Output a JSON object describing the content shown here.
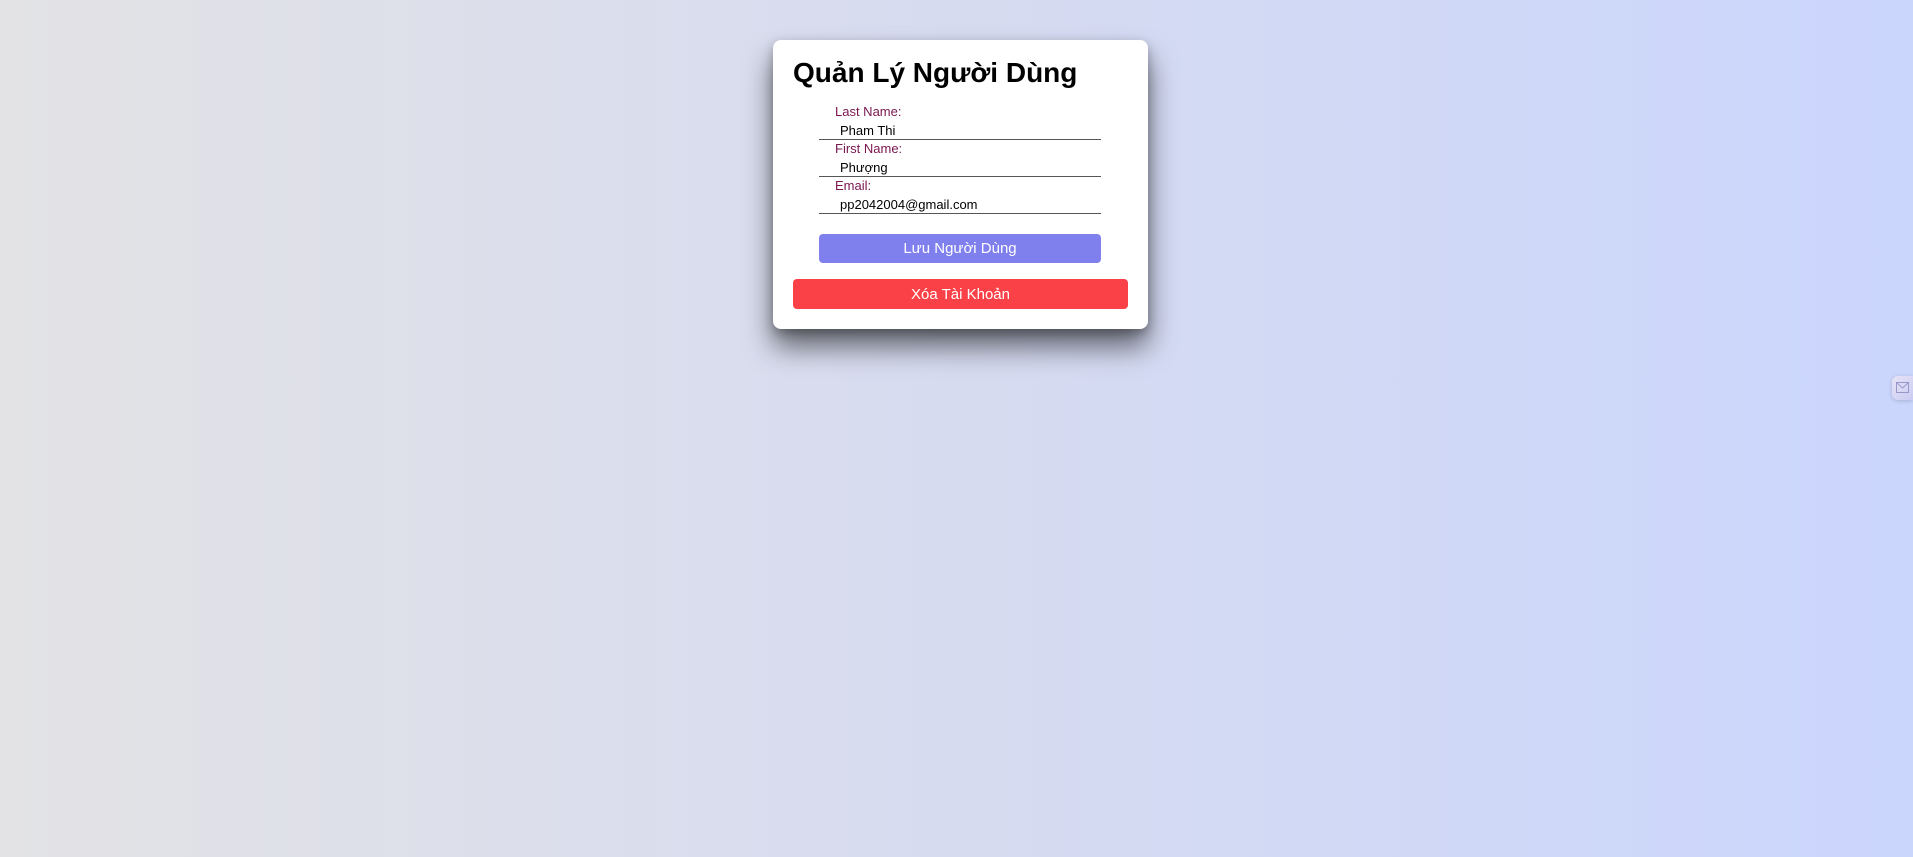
{
  "page": {
    "title": "Quản Lý Người Dùng"
  },
  "form": {
    "last_name": {
      "label": "Last Name:",
      "value": "Pham Thi"
    },
    "first_name": {
      "label": "First Name:",
      "value": "Phượng"
    },
    "email": {
      "label": "Email:",
      "value": "pp2042004@gmail.com"
    }
  },
  "actions": {
    "save_label": "Lưu Người Dùng",
    "delete_label": "Xóa Tài Khoản"
  },
  "colors": {
    "label": "#7a1650",
    "save_button": "#7f7fee",
    "delete_button": "#fb4148"
  },
  "side_widget": {
    "icon": "mail-icon"
  }
}
